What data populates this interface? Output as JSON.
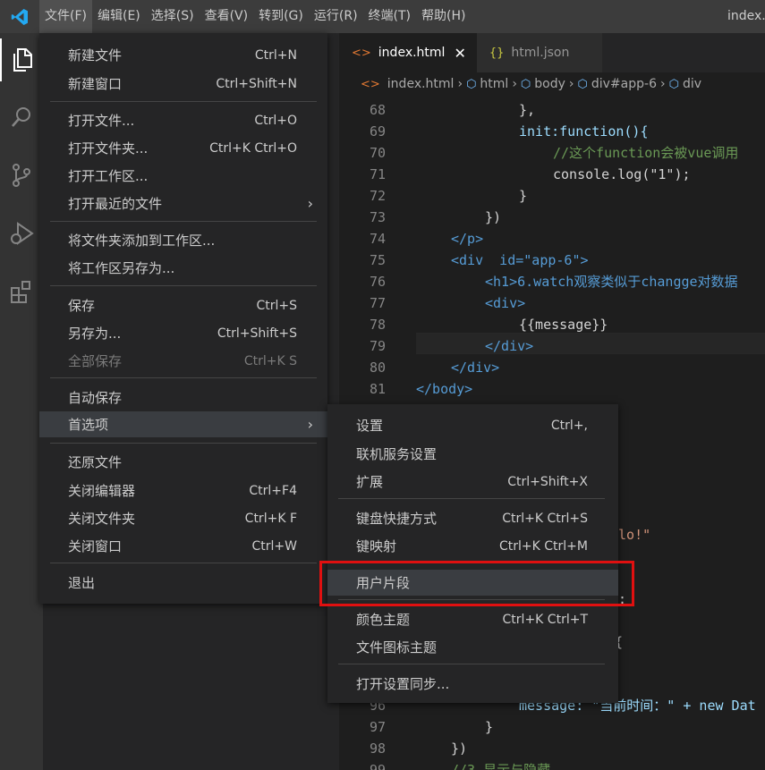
{
  "menubar": {
    "items": [
      "文件(F)",
      "编辑(E)",
      "选择(S)",
      "查看(V)",
      "转到(G)",
      "运行(R)",
      "终端(T)",
      "帮助(H)"
    ],
    "title": "index."
  },
  "tabs": [
    {
      "label": "index.html",
      "icon": "<>",
      "active": true
    },
    {
      "label": "html.json",
      "icon": "{}",
      "active": false
    }
  ],
  "breadcrumb": [
    "index.html",
    "html",
    "body",
    "div#app-6",
    "div"
  ],
  "code_lines": [
    {
      "n": "68",
      "text": "},"
    },
    {
      "n": "69",
      "text": "init:function(){"
    },
    {
      "n": "70",
      "text": "//这个function会被vue调用"
    },
    {
      "n": "71",
      "text": "console.log(\"1\");"
    },
    {
      "n": "72",
      "text": "}"
    },
    {
      "n": "73",
      "text": "})"
    },
    {
      "n": "74",
      "text": "</p>"
    },
    {
      "n": "75",
      "text": "<div  id=\"app-6\">"
    },
    {
      "n": "76",
      "text": "<h1>6.watch观察类似于changge对数据"
    },
    {
      "n": "77",
      "text": "<div>"
    },
    {
      "n": "78",
      "text": "{{message}}"
    },
    {
      "n": "79",
      "text": "</div>"
    },
    {
      "n": "80",
      "text": "</div>"
    },
    {
      "n": "81",
      "text": "</body>"
    }
  ],
  "code_tail": {
    "hello": "llo!\"",
    "colon": ":",
    "brace": "{",
    "l96n": "96",
    "l96": "message: \"当前时间：\" + new Dat",
    "l97n": "97",
    "l97": "}",
    "l98n": "98",
    "l98": "})",
    "l99n": "99",
    "l99": "//3.显示与隐藏"
  },
  "file_menu": {
    "items": [
      {
        "label": "新建文件",
        "shortcut": "Ctrl+N"
      },
      {
        "label": "新建窗口",
        "shortcut": "Ctrl+Shift+N"
      },
      {
        "label": "打开文件...",
        "shortcut": "Ctrl+O"
      },
      {
        "label": "打开文件夹...",
        "shortcut": "Ctrl+K Ctrl+O"
      },
      {
        "label": "打开工作区...",
        "shortcut": ""
      },
      {
        "label": "打开最近的文件",
        "shortcut": ""
      },
      {
        "label": "将文件夹添加到工作区...",
        "shortcut": ""
      },
      {
        "label": "将工作区另存为...",
        "shortcut": ""
      },
      {
        "label": "保存",
        "shortcut": "Ctrl+S"
      },
      {
        "label": "另存为...",
        "shortcut": "Ctrl+Shift+S"
      },
      {
        "label": "全部保存",
        "shortcut": "Ctrl+K S"
      },
      {
        "label": "自动保存",
        "shortcut": ""
      },
      {
        "label": "首选项",
        "shortcut": ""
      },
      {
        "label": "还原文件",
        "shortcut": ""
      },
      {
        "label": "关闭编辑器",
        "shortcut": "Ctrl+F4"
      },
      {
        "label": "关闭文件夹",
        "shortcut": "Ctrl+K F"
      },
      {
        "label": "关闭窗口",
        "shortcut": "Ctrl+W"
      },
      {
        "label": "退出",
        "shortcut": ""
      }
    ]
  },
  "pref_menu": {
    "items": [
      {
        "label": "设置",
        "shortcut": "Ctrl+,"
      },
      {
        "label": "联机服务设置",
        "shortcut": ""
      },
      {
        "label": "扩展",
        "shortcut": "Ctrl+Shift+X"
      },
      {
        "label": "键盘快捷方式",
        "shortcut": "Ctrl+K Ctrl+S"
      },
      {
        "label": "键映射",
        "shortcut": "Ctrl+K Ctrl+M"
      },
      {
        "label": "用户片段",
        "shortcut": ""
      },
      {
        "label": "颜色主题",
        "shortcut": "Ctrl+K Ctrl+T"
      },
      {
        "label": "文件图标主题",
        "shortcut": ""
      },
      {
        "label": "打开设置同步...",
        "shortcut": ""
      }
    ]
  },
  "colors": {
    "accent_highlight_box": "#e01010",
    "vscode_blue": "#23a9f2"
  }
}
